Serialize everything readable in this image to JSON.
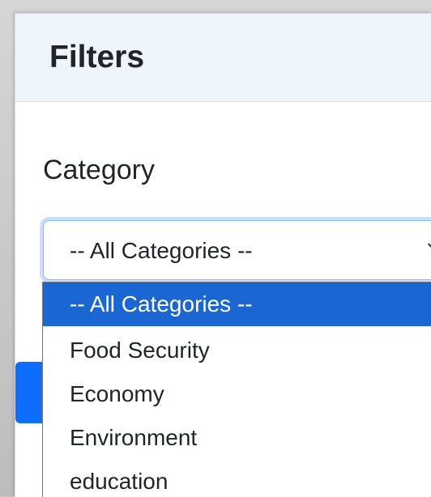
{
  "panel": {
    "title": "Filters"
  },
  "category_filter": {
    "label": "Category",
    "selected_value": "-- All Categories --",
    "options": [
      {
        "label": "-- All Categories --",
        "selected": true
      },
      {
        "label": "Food Security",
        "selected": false
      },
      {
        "label": "Economy",
        "selected": false
      },
      {
        "label": "Environment",
        "selected": false
      },
      {
        "label": "education",
        "selected": false
      }
    ]
  },
  "colors": {
    "header_bg": "#eef5fb",
    "selected_option_bg": "#1a66d2",
    "focus_ring": "#86b7fe",
    "primary_button": "#0d6efd"
  },
  "icons": {
    "select_arrow": "chevron-down-icon"
  }
}
